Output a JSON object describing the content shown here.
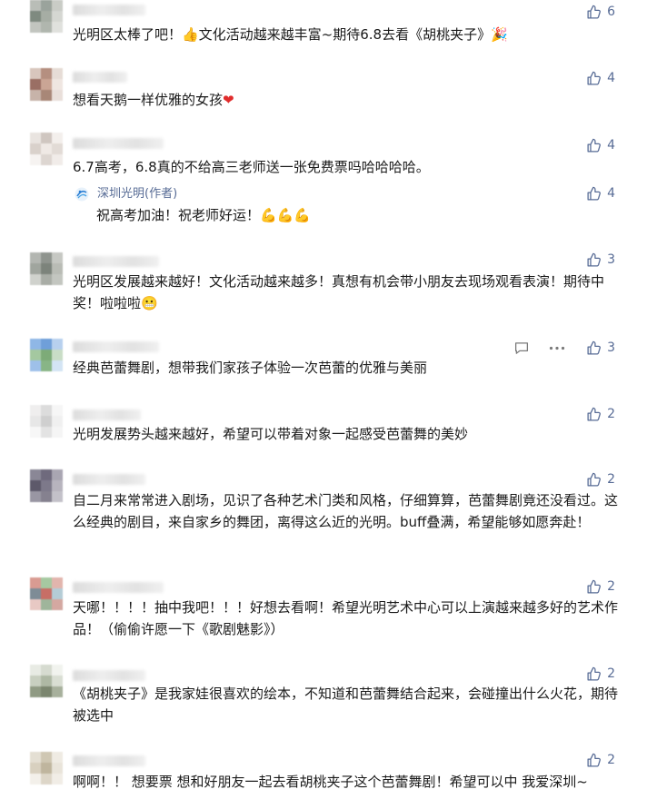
{
  "colors": {
    "link": "#576b95",
    "text": "#1a1a1a",
    "heart": "#e02c2c",
    "emoji_yellow": "#f5c518"
  },
  "comments": [
    {
      "text": "光明区太棒了吧！👍文化活动越来越丰富~期待6.8去看《胡桃夹子》🎉",
      "likes": "6"
    },
    {
      "text": "想看天鹅一样优雅的女孩❤",
      "likes": "4"
    },
    {
      "text": "6.7高考，6.8真的不给高三老师送一张免费票吗哈哈哈哈。",
      "likes": "4",
      "reply": {
        "author": "深圳光明(作者)",
        "text": "祝高考加油！祝老师好运！💪💪💪",
        "likes": "4"
      }
    },
    {
      "text": "光明区发展越来越好！文化活动越来越多！真想有机会带小朋友去现场观看表演！期待中奖！啦啦啦😬",
      "likes": "3"
    },
    {
      "text": "经典芭蕾舞剧，想带我们家孩子体验一次芭蕾的优雅与美丽",
      "likes": "3"
    },
    {
      "text": "光明发展势头越来越好，希望可以带着对象一起感受芭蕾舞的美妙",
      "likes": "2"
    },
    {
      "text": "自二月来常常进入剧场，见识了各种艺术门类和风格，仔细算算，芭蕾舞剧竟还没看过。这么经典的剧目，来自家乡的舞团，离得这么近的光明。buff叠满，希望能够如愿奔赴！",
      "likes": "2"
    },
    {
      "text": "天哪！！！！抽中我吧！！！好想去看啊！希望光明艺术中心可以上演越来越多好的艺术作品！（偷偷许愿一下《歌剧魅影》）",
      "likes": "2"
    },
    {
      "text": "《胡桃夹子》是我家娃很喜欢的绘本，不知道和芭蕾舞结合起来，会碰撞出什么火花，期待被选中",
      "likes": "2"
    },
    {
      "text": "啊啊！！ 想要票 想和好朋友一起去看胡桃夹子这个芭蕾舞剧！希望可以中 我爱深圳~",
      "likes": "2"
    }
  ]
}
